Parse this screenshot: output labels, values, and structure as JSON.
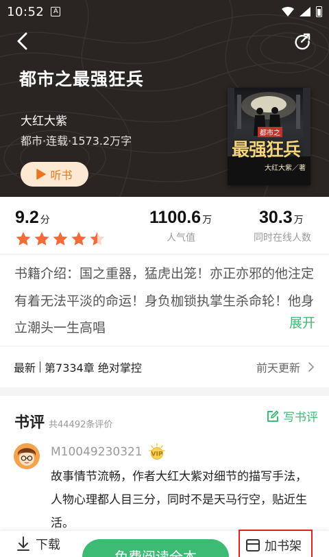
{
  "status_bar": {
    "time": "10:52",
    "a_icon": "A"
  },
  "header": {
    "title": "都市之最强狂兵",
    "author": "大红大紫",
    "meta": "都市·连载·1573.2万字",
    "listen_label": "听书"
  },
  "cover": {
    "top_text": "都市之",
    "main_text": "最强狂兵",
    "author_text": "大红大紫／著"
  },
  "stats": {
    "rating": {
      "value": "9.2",
      "unit": "分",
      "stars": 4.5
    },
    "popularity": {
      "value": "1100.6",
      "unit": "万",
      "label": "人气值"
    },
    "online": {
      "value": "30.3",
      "unit": "万",
      "label": "同时在线人数"
    }
  },
  "intro": {
    "text": "书籍介绍：国之重器，猛虎出笼！亦正亦邪的他注定有着无法平淡的命运！身负枷锁执掌生杀命轮！他身立潮头一生高唱",
    "expand_label": "展开"
  },
  "latest": {
    "label": "最新",
    "chapter": "第7334章 绝对掌控",
    "update": "前天更新"
  },
  "reviews": {
    "title": "书评",
    "count": "共44492条评价",
    "write_label": "写书评",
    "items": [
      {
        "user": "M10049230321",
        "badge": "VIP",
        "text": "故事情节流畅，作者大红大紫对细节的描写手法，人物心理都人目三分，同时不是天马行空，贴近生活。"
      }
    ]
  },
  "bottom_bar": {
    "download_label": "下载",
    "read_label": "免费阅读全本",
    "add_shelf_label": "加书架"
  },
  "colors": {
    "accent_green": "#3dbb75",
    "listen_orange": "#e9761c",
    "star_orange": "#f26b3a",
    "hero_bg": "#2a2522",
    "highlight_red": "#e02020"
  }
}
